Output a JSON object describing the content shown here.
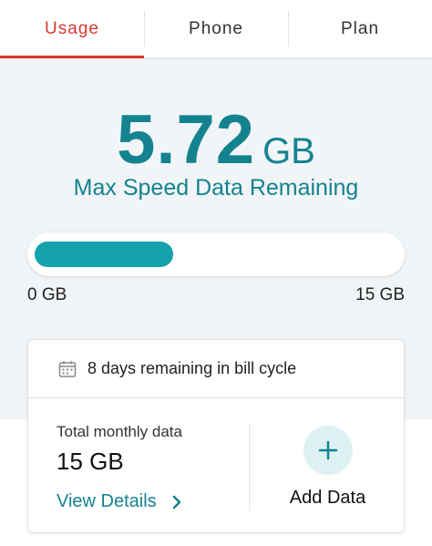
{
  "tabs": [
    {
      "label": "Usage",
      "active": true
    },
    {
      "label": "Phone",
      "active": false
    },
    {
      "label": "Plan",
      "active": false
    }
  ],
  "usage": {
    "amount": "5.72",
    "unit": "GB",
    "subtitle": "Max Speed Data Remaining",
    "progress_fraction": 0.381,
    "bar_min_label": "0 GB",
    "bar_max_label": "15 GB"
  },
  "card": {
    "cycle_text": "8 days remaining in bill cycle",
    "total_label": "Total monthly data",
    "total_value": "15 GB",
    "view_details_label": "View Details",
    "add_data_label": "Add Data"
  },
  "icons": {
    "calendar": "calendar-icon",
    "chevron": "chevron-right-icon",
    "plus": "plus-icon"
  },
  "colors": {
    "accent_red": "#d7392e",
    "teal": "#14838f",
    "bar_fill": "#14a2ae",
    "add_circle": "#ddf1f3"
  }
}
